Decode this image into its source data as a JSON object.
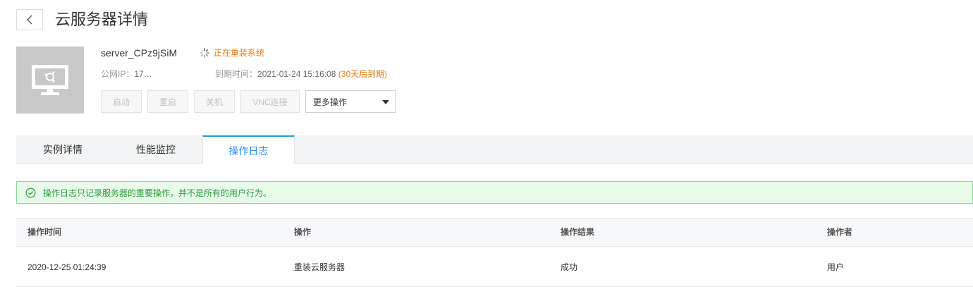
{
  "header": {
    "title": "云服务器详情",
    "back_icon": "chevron-left-icon"
  },
  "server": {
    "name": "server_CPz9jSiM",
    "status_icon": "spinner-icon",
    "status_text": "正在重装系统",
    "ip_label": "公网IP：",
    "ip_value": "17…",
    "expire_label": "到期时间：",
    "expire_value": "2021-01-24 15:16:08",
    "expire_note": "(30天后到期)",
    "thumbnail_icon": "monitor-icon"
  },
  "actions": {
    "start": "启动",
    "restart": "重启",
    "shutdown": "关机",
    "vnc": "VNC连接",
    "more": "更多操作"
  },
  "tabs": [
    {
      "label": "实例详情"
    },
    {
      "label": "性能监控"
    },
    {
      "label": "操作日志"
    }
  ],
  "active_tab": "操作日志",
  "notice": {
    "text": "操作日志只记录服务器的重要操作，并不是所有的用户行为。",
    "icon": "check-circle-icon"
  },
  "table": {
    "columns": [
      "操作时间",
      "操作",
      "操作结果",
      "操作者"
    ],
    "rows": [
      [
        "2020-12-25 01:24:39",
        "重装云服务器",
        "成功",
        "用户"
      ]
    ]
  },
  "colors": {
    "accent": "#1aa0e6",
    "warning": "#e07b14",
    "success": "#2a9a3a"
  }
}
